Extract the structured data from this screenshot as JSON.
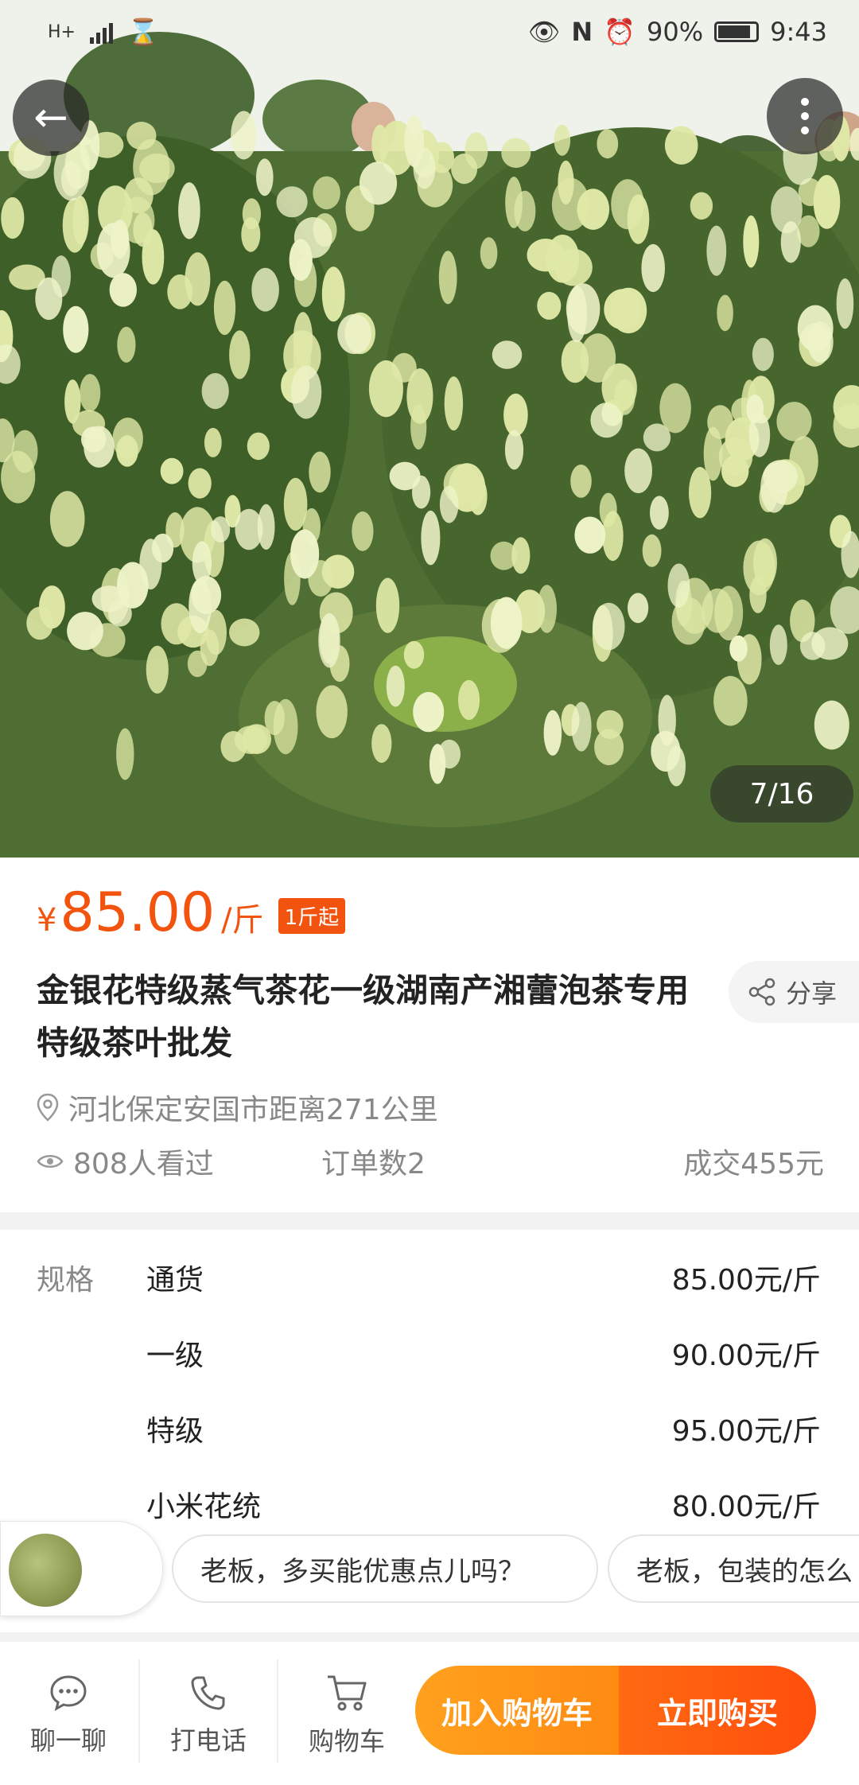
{
  "status_bar": {
    "network": "H+",
    "battery": "90%",
    "time": "9:43"
  },
  "gallery": {
    "counter": "7/16"
  },
  "product": {
    "currency": "¥",
    "price": "85.00",
    "unit": "/斤",
    "min_order": "1斤起",
    "title": "金银花特级蒸气茶花一级湖南产湘蕾泡茶专用特级茶叶批发",
    "share_label": "分享",
    "location": "河北保定安国市距离271公里",
    "views": "808人看过",
    "orders": "订单数2",
    "deals": "成交455元"
  },
  "specs": {
    "label": "规格",
    "items": [
      {
        "name": "通货",
        "price": "85.00元/斤"
      },
      {
        "name": "一级",
        "price": "90.00元/斤"
      },
      {
        "name": "特级",
        "price": "95.00元/斤"
      },
      {
        "name": "小米花统",
        "price": "80.00元/斤"
      }
    ]
  },
  "quick_questions": [
    "老板，多买能优惠点儿吗？",
    "老板，包装的怎么"
  ],
  "bottom_bar": {
    "chat": "聊一聊",
    "call": "打电话",
    "cart": "购物车",
    "add_to_cart": "加入购物车",
    "buy_now": "立即购买"
  },
  "colors": {
    "accent": "#f2530e",
    "cart_button": "#ff9418",
    "buy_button": "#ff5a0e"
  }
}
